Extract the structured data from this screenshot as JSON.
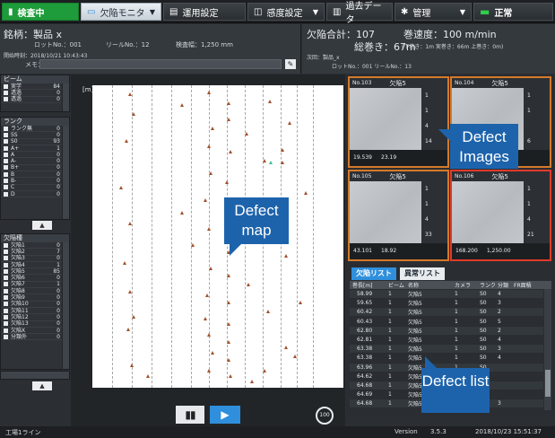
{
  "topbar": {
    "status": "検査中",
    "defect_monitor": "欠陥モニタ",
    "run_settings": "運用設定",
    "sensitivity_settings": "感度設定",
    "roll_data": "過去データ",
    "management": "管理",
    "normal": "正常"
  },
  "info": {
    "product_label": "銘柄：製品 x",
    "lot": "ロットNo.：001",
    "reel": "リールNo.：12",
    "width": "検査幅：1,250 mm",
    "start_time": "開始時刻：2018/10/21 10:43:43",
    "memo_label": "メモ：",
    "defect_total": "欠陥合計：107",
    "speed": "巻速度：100 m/min",
    "total_length": "総巻き：67m",
    "length_detail": "(下巻き：1m 実巻き：66m 上巻き：0m)",
    "next_product": "次回：製品_x",
    "next_lot": "ロットNo.：001 リールNo.：13"
  },
  "beam": {
    "header": "ビーム",
    "items": [
      {
        "label": "実学",
        "value": "84"
      },
      {
        "label": "透過",
        "value": "0"
      },
      {
        "label": "透過",
        "value": "0"
      }
    ]
  },
  "rank": {
    "header": "ランク",
    "items": [
      {
        "label": "ランク無",
        "value": "0"
      },
      {
        "label": "SS",
        "value": "0"
      },
      {
        "label": "S0",
        "value": "93"
      },
      {
        "label": "A+",
        "value": "1"
      },
      {
        "label": "A",
        "value": "0"
      },
      {
        "label": "A-",
        "value": "0"
      },
      {
        "label": "B+",
        "value": "0"
      },
      {
        "label": "B",
        "value": "0"
      },
      {
        "label": "B-",
        "value": "0"
      },
      {
        "label": "C",
        "value": "0"
      },
      {
        "label": "D",
        "value": "0"
      }
    ]
  },
  "defect_types": {
    "header": "欠陥種",
    "items": [
      {
        "label": "欠陥1",
        "value": "0"
      },
      {
        "label": "欠陥2",
        "value": "7"
      },
      {
        "label": "欠陥3",
        "value": "0"
      },
      {
        "label": "欠陥4",
        "value": "1"
      },
      {
        "label": "欠陥5",
        "value": "85"
      },
      {
        "label": "欠陥6",
        "value": "0"
      },
      {
        "label": "欠陥7",
        "value": "1"
      },
      {
        "label": "欠陥8",
        "value": "0"
      },
      {
        "label": "欠陥9",
        "value": "0"
      },
      {
        "label": "欠陥10",
        "value": "0"
      },
      {
        "label": "欠陥11",
        "value": "0"
      },
      {
        "label": "欠陥12",
        "value": "0"
      },
      {
        "label": "欠陥13",
        "value": "0"
      },
      {
        "label": "欠陥X",
        "value": "0"
      },
      {
        "label": "分類外",
        "value": "0"
      }
    ]
  },
  "map": {
    "unit": "[m]",
    "ticks": [
      "100",
      "200",
      "300",
      "400",
      "500",
      "600",
      "700",
      "800",
      "900",
      "1,000",
      "1,100",
      "1,200",
      "1250"
    ]
  },
  "images": [
    {
      "no": "No.103",
      "name": "欠陥5",
      "v1": "1",
      "v2": "1",
      "v3": "4",
      "v4": "14",
      "pos": "19.539",
      "width": "23.19"
    },
    {
      "no": "No.104",
      "name": "欠陥5",
      "v1": "1",
      "v2": "1",
      "v3": "",
      "v4": "6",
      "pos": "",
      "width": ""
    },
    {
      "no": "No.105",
      "name": "欠陥5",
      "v1": "1",
      "v2": "1",
      "v3": "4",
      "v4": "33",
      "pos": "43.101",
      "width": "18.92"
    },
    {
      "no": "No.106",
      "name": "欠陥5",
      "v1": "1",
      "v2": "1",
      "v3": "4",
      "v4": "21",
      "pos": "168.200",
      "width": "1,250.00"
    }
  ],
  "list": {
    "tab_defects": "欠陥リスト",
    "tab_abnormal": "異常リスト",
    "columns": [
      "巻長[m]",
      "ビーム",
      "名称",
      "カメラ",
      "ランク",
      "分類",
      "FR面積"
    ],
    "rows": [
      [
        "58.99",
        "1",
        "欠陥5",
        "1",
        "S0",
        "4",
        ""
      ],
      [
        "59.65",
        "1",
        "欠陥5",
        "1",
        "S0",
        "3",
        ""
      ],
      [
        "60.42",
        "1",
        "欠陥5",
        "1",
        "S0",
        "2",
        ""
      ],
      [
        "60.43",
        "1",
        "欠陥5",
        "1",
        "S0",
        "5",
        ""
      ],
      [
        "62.80",
        "1",
        "欠陥5",
        "1",
        "S0",
        "2",
        ""
      ],
      [
        "62.81",
        "1",
        "欠陥5",
        "1",
        "S0",
        "4",
        ""
      ],
      [
        "63.38",
        "1",
        "欠陥5",
        "1",
        "S0",
        "3",
        ""
      ],
      [
        "63.38",
        "1",
        "欠陥5",
        "1",
        "S0",
        "4",
        ""
      ],
      [
        "63.96",
        "1",
        "欠陥5",
        "1",
        "S0",
        "",
        ""
      ],
      [
        "64.62",
        "1",
        "欠陥5",
        "1",
        "S0",
        "",
        ""
      ],
      [
        "64.68",
        "1",
        "欠陥5",
        "1",
        "S0",
        "",
        ""
      ],
      [
        "64.69",
        "1",
        "欠陥5",
        "1",
        "S0",
        "",
        ""
      ],
      [
        "64.68",
        "1",
        "欠陥5",
        "1",
        "S0",
        "3",
        ""
      ]
    ]
  },
  "callouts": {
    "map": "Defect map",
    "images": "Defect Images",
    "list": "Defect list"
  },
  "footer": {
    "line": "工場1ライン",
    "version_label": "Version",
    "version": "3.5.3",
    "datetime": "2018/10/23 15:51:37"
  }
}
